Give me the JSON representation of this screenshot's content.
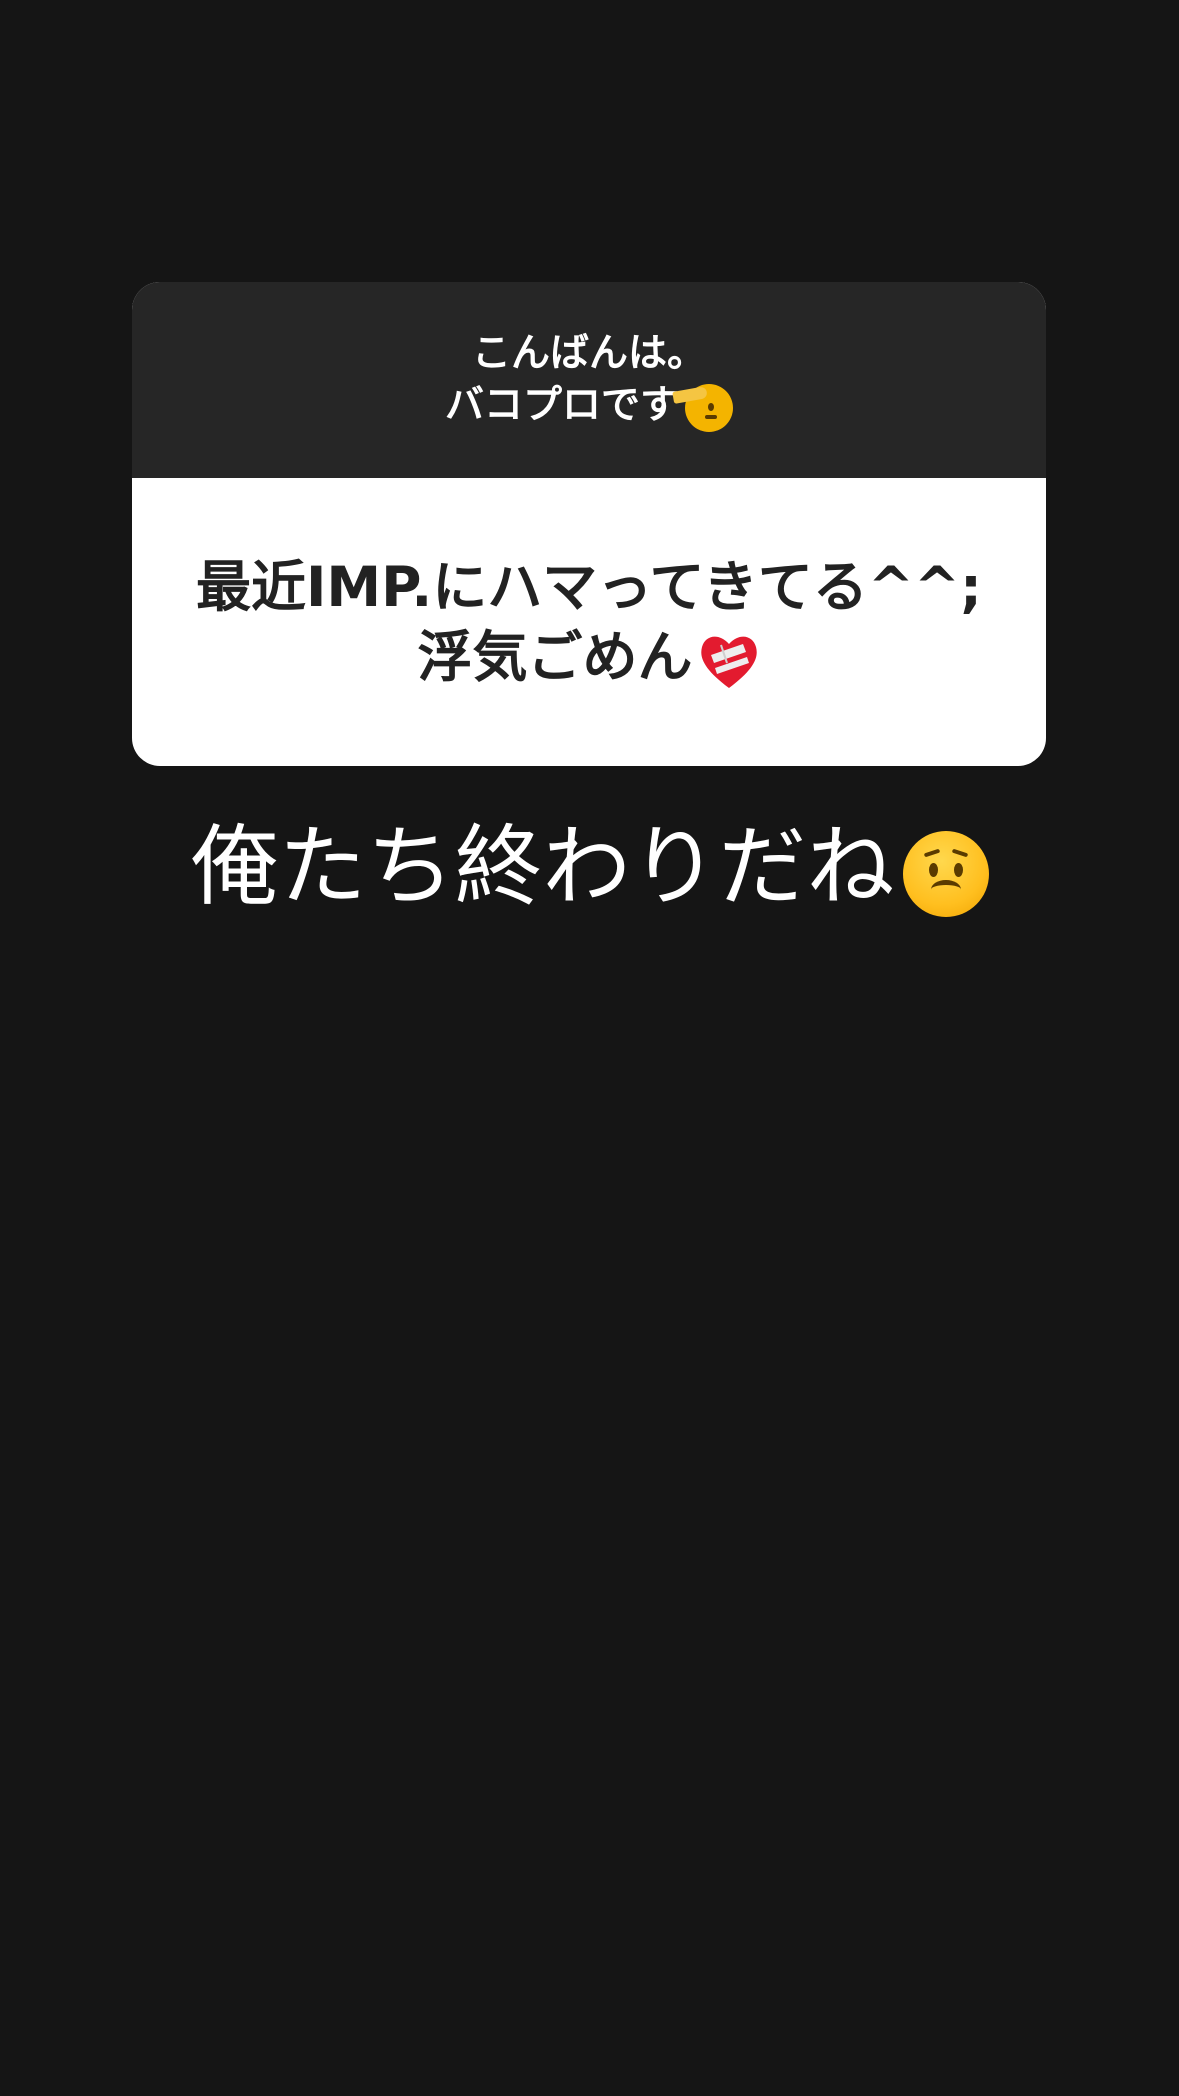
{
  "story": {
    "question_card": {
      "prompt_line_1": "こんばんは。",
      "prompt_line_2": "バコプロです",
      "prompt_emoji": "saluting-face-icon",
      "answer_line_1": "最近IMP.にハマってきてる^^;",
      "answer_line_2": "浮気ごめん",
      "answer_emoji": "mending-heart-icon"
    },
    "reply_text": "俺たち終わりだね",
    "reply_emoji": "worried-face-icon",
    "colors": {
      "background": "#151515",
      "card_header": "#262626",
      "card_body": "#ffffff",
      "answer_text": "#222222"
    }
  }
}
